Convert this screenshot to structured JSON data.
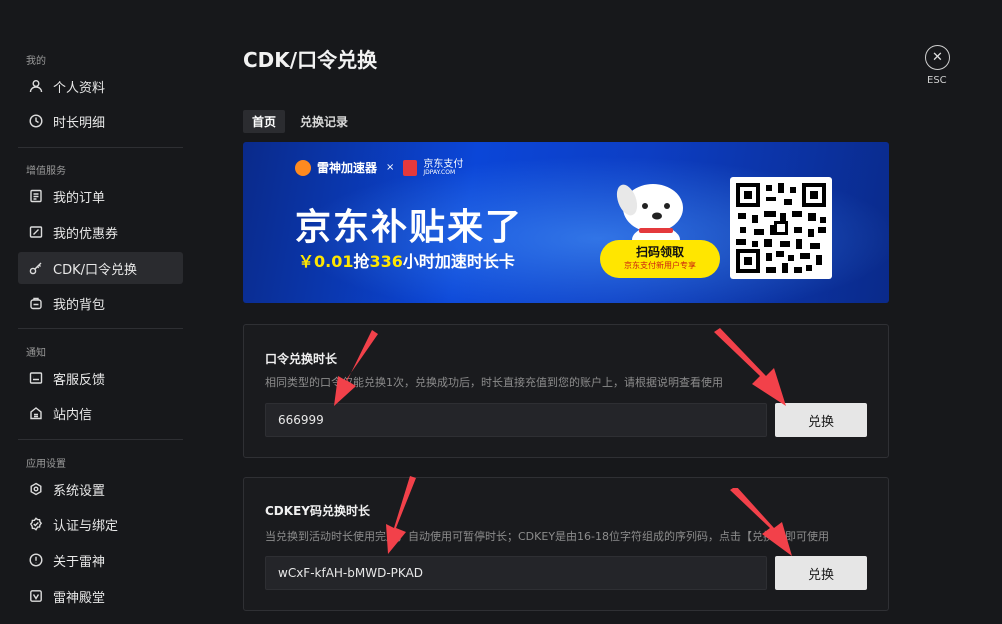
{
  "sidebar": {
    "sections": [
      {
        "title": "我的",
        "items": [
          {
            "label": "个人资料",
            "icon": "user-icon"
          },
          {
            "label": "时长明细",
            "icon": "clock-icon"
          }
        ]
      },
      {
        "title": "增值服务",
        "items": [
          {
            "label": "我的订单",
            "icon": "order-icon"
          },
          {
            "label": "我的优惠券",
            "icon": "coupon-icon"
          },
          {
            "label": "CDK/口令兑换",
            "icon": "key-icon",
            "active": true
          },
          {
            "label": "我的背包",
            "icon": "backpack-icon"
          }
        ]
      },
      {
        "title": "通知",
        "items": [
          {
            "label": "客服反馈",
            "icon": "feedback-icon"
          },
          {
            "label": "站内信",
            "icon": "mailbox-icon"
          }
        ]
      },
      {
        "title": "应用设置",
        "items": [
          {
            "label": "系统设置",
            "icon": "gear-icon"
          },
          {
            "label": "认证与绑定",
            "icon": "verified-icon"
          },
          {
            "label": "关于雷神",
            "icon": "info-icon"
          },
          {
            "label": "雷神殿堂",
            "icon": "hall-icon"
          }
        ]
      }
    ]
  },
  "header": {
    "title": "CDK/口令兑换",
    "esc_label": "ESC"
  },
  "tabs": [
    {
      "label": "首页",
      "active": true
    },
    {
      "label": "兑换记录",
      "active": false
    }
  ],
  "banner": {
    "brand": "雷神加速器",
    "cross": "×",
    "partner": "京东支付",
    "partner_sub": "JDPAY.COM",
    "headline": "京东补贴来了",
    "sub_price": "￥0.01",
    "sub_mid": "抢",
    "sub_hours": "336",
    "sub_tail": "小时加速时长卡",
    "pill_title": "扫码领取",
    "pill_sub": "京东支付新用户专享"
  },
  "command_redeem": {
    "title": "口令兑换时长",
    "description": "相同类型的口令仅能兑换1次，兑换成功后，时长直接充值到您的账户上，请根据说明查看使用",
    "input_value": "666999",
    "button_label": "兑换"
  },
  "cdkey_redeem": {
    "title": "CDKEY码兑换时长",
    "description": "当兑换到活动时长使用完后，自动使用可暂停时长；CDKEY是由16-18位字符组成的序列码，点击【兑换】即可使用",
    "input_value": "wCxF-kfAH-bMWD-PKAD",
    "button_label": "兑换"
  },
  "colors": {
    "background": "#17181b",
    "active_nav": "#2a2b2f",
    "button": "#e6e6e6",
    "arrow": "#f2414a",
    "banner_blue": "#0b46d8",
    "highlight_yellow": "#ffe600"
  }
}
